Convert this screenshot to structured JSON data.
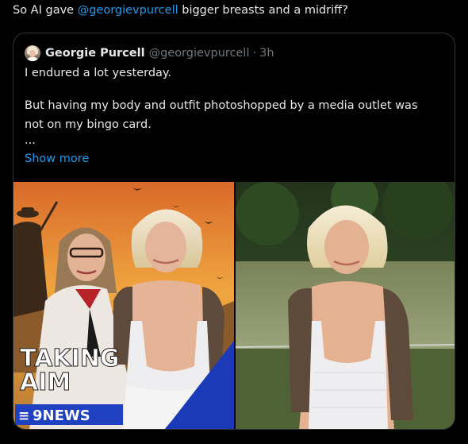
{
  "post": {
    "prefix": "So AI gave ",
    "mention": "@georgievpurcell",
    "suffix": " bigger breasts and a midriff?"
  },
  "quote": {
    "name": "Georgie Purcell",
    "handle": "@georgievpurcell",
    "separator": "·",
    "time": "3h",
    "lines": [
      "I endured a lot yesterday.",
      "But having my body and outfit photoshopped by a media outlet was",
      "not on my bingo card.",
      "..."
    ],
    "show_more": "Show more"
  },
  "media": {
    "left_caption_line1": "TAKING",
    "left_caption_line2": "AIM",
    "left_brand": "9NEWS",
    "left_brand_prefix": "≡"
  },
  "colors": {
    "accent": "#1d9bf0",
    "muted": "#71767b",
    "text": "#e7e9ea",
    "border": "#2f3336"
  }
}
